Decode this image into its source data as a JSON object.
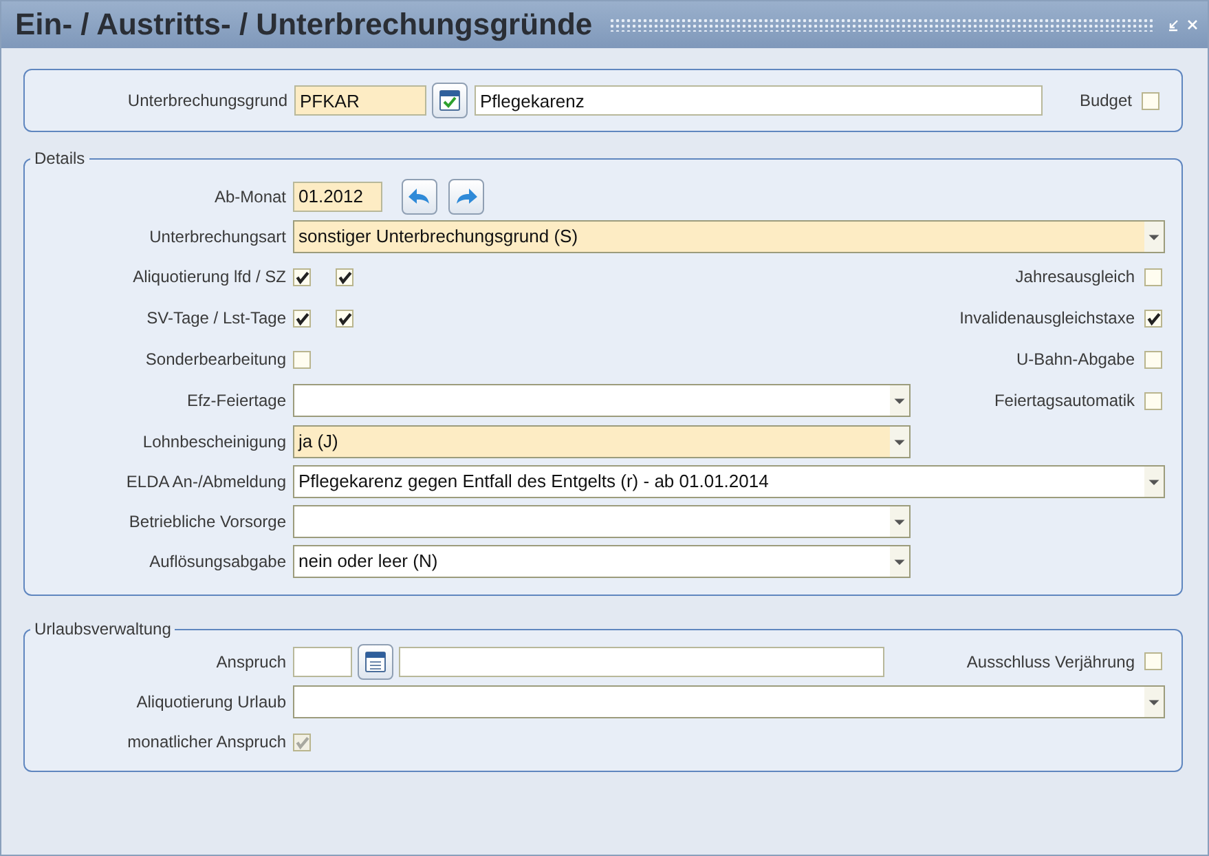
{
  "window": {
    "title": "Ein- / Austritts- / Unterbrechungsgründe"
  },
  "header": {
    "label": "Unterbrechungsgrund",
    "code": "PFKAR",
    "name": "Pflegekarenz",
    "budget": {
      "label": "Budget",
      "checked": false
    }
  },
  "details": {
    "legend": "Details",
    "ab_monat": {
      "label": "Ab-Monat",
      "value": "01.2012"
    },
    "unterbrechungsart": {
      "label": "Unterbrechungsart",
      "value": "sonstiger Unterbrechungsgrund (S)",
      "required": true
    },
    "left_checks": [
      {
        "label": "Aliquotierung lfd / SZ",
        "boxes": [
          {
            "checked": true
          },
          {
            "checked": true
          }
        ]
      },
      {
        "label": "SV-Tage / Lst-Tage",
        "boxes": [
          {
            "checked": true
          },
          {
            "checked": true
          }
        ]
      },
      {
        "label": "Sonderbearbeitung",
        "boxes": [
          {
            "checked": false
          }
        ]
      }
    ],
    "right_checks": [
      {
        "label": "Jahresausgleich",
        "checked": false
      },
      {
        "label": "Invalidenausgleichstaxe",
        "checked": true
      },
      {
        "label": "U-Bahn-Abgabe",
        "checked": false
      },
      {
        "label": "Feiertagsautomatik",
        "checked": false
      }
    ],
    "selects": [
      {
        "label": "Efz-Feiertage",
        "required": false
      },
      {
        "label": "Lohnbescheinigung",
        "value": "ja (J)",
        "required": true
      },
      {
        "label": "ELDA An-/Abmeldung",
        "value": "Pflegekarenz gegen Entfall des Entgelts (r) - ab 01.01.2014",
        "required": false
      },
      {
        "label": "Betriebliche Vorsorge",
        "required": false
      },
      {
        "label": "Auflösungsabgabe",
        "value": "nein oder leer (N)",
        "required": false
      }
    ]
  },
  "urlaub": {
    "legend": "Urlaubsverwaltung",
    "anspruch": {
      "label": "Anspruch"
    },
    "ausschluss": {
      "label": "Ausschluss Verjährung",
      "checked": false
    },
    "aliquotierung": {
      "label": "Aliquotierung Urlaub"
    },
    "monatlich": {
      "label": "monatlicher Anspruch",
      "checked": true,
      "disabled": true
    }
  }
}
